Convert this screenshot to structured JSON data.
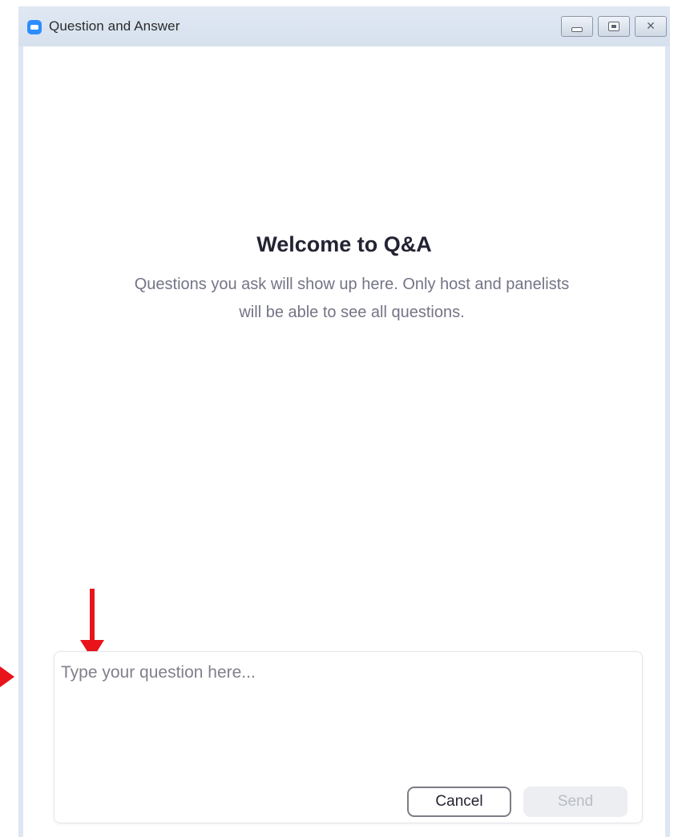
{
  "window": {
    "title": "Question and Answer",
    "icon": "zoom-app-icon",
    "controls": {
      "minimize_icon": "minimize-icon",
      "maximize_icon": "maximize-icon",
      "close_icon": "close-icon",
      "close_glyph": "✕"
    }
  },
  "main": {
    "welcome_title": "Welcome to Q&A",
    "welcome_subtitle": "Questions you ask will show up here. Only host and panelists will be able to see all questions."
  },
  "question_box": {
    "placeholder": "Type your question here...",
    "value": "",
    "cancel_label": "Cancel",
    "send_label": "Send"
  },
  "colors": {
    "annotation_arrow": "#e8141a",
    "brand_blue": "#2d8cff",
    "titlebar": "#dce5f0"
  }
}
